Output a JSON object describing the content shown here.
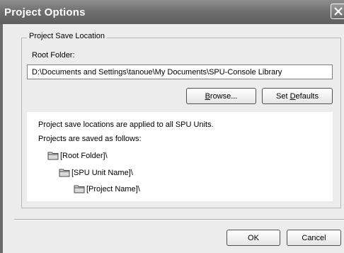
{
  "window": {
    "title": "Project Options"
  },
  "group": {
    "legend": "Project Save Location",
    "root_folder_label": "Root Folder:",
    "root_folder_value": "D:\\Documents and Settings\\tanoue\\My Documents\\SPU-Console Library"
  },
  "buttons": {
    "browse_label": "Browse...",
    "browse_mnemonic": "B",
    "browse_rest": "rowse...",
    "set_defaults_prefix": "Set ",
    "set_defaults_mnemonic": "D",
    "set_defaults_rest": "efaults",
    "ok_label": "OK",
    "cancel_label": "Cancel"
  },
  "info": {
    "line1": "Project save locations are applied to all SPU Units.",
    "line2": "Projects are saved as follows:",
    "tree": [
      {
        "label": "[Root Folder]\\",
        "icon": "folder-icon"
      },
      {
        "label": "[SPU Unit Name]\\",
        "icon": "folder-icon"
      },
      {
        "label": "[Project Name]\\",
        "icon": "folder-icon"
      }
    ]
  },
  "colors": {
    "titlebar": "#707070",
    "dialog_bg": "#ececec"
  }
}
